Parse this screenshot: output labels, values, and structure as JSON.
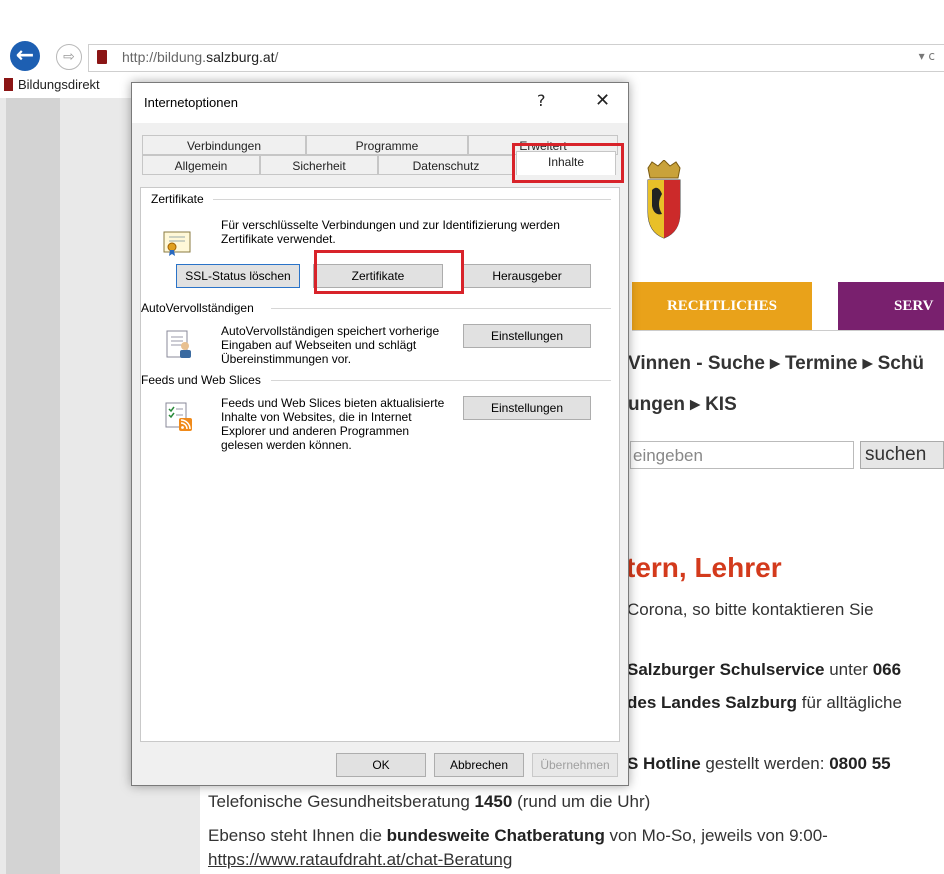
{
  "browser": {
    "url_prefix": "http://bildung.",
    "url_domain": "salzburg.at",
    "url_suffix": "/",
    "tab_title": "Bildungsdirekt"
  },
  "website": {
    "nav": {
      "rechtliches": "RECHTLICHES",
      "service": "SERV"
    },
    "quicklinks_line1": "Vinnen - Suche  ▸ Termine  ▸ Schü",
    "quicklinks_line2": "ungen  ▸ KIS",
    "search_placeholder": "eingeben",
    "search_button": "suchen",
    "heading": "tern, Lehrer",
    "p1": " Corona, so bitte kontaktieren Sie",
    "p2_bold": "Salzburger Schulservice",
    "p2_rest": " unter ",
    "p2_num": "066",
    "p3_bold": "des Landes Salzburg",
    "p3_rest": " für alltägliche",
    "p4_bold": "S Hotline",
    "p4_rest": " gestellt werden: ",
    "p4_num": "0800 55",
    "p5_pre": "Telefonische Gesundheitsberatung ",
    "p5_bold": "1450",
    "p5_post": " (rund um die Uhr)",
    "p6_pre": "Ebenso steht Ihnen die ",
    "p6_bold": "bundesweite Chatberatung",
    "p6_post": " von Mo-So, jeweils von 9:00-",
    "p7_link": "https://www.rataufdraht.at/chat-Beratung"
  },
  "dialog": {
    "title": "Internetoptionen",
    "help": "?",
    "close": "✕",
    "tabs_row1": [
      "Verbindungen",
      "Programme",
      "Erweitert"
    ],
    "tabs_row2": [
      "Allgemein",
      "Sicherheit",
      "Datenschutz",
      "Inhalte"
    ],
    "cert_group": "Zertifikate",
    "cert_text": "Für verschlüsselte Verbindungen und zur Identifizierung werden Zertifikate verwendet.",
    "btn_ssl": "SSL-Status löschen",
    "btn_cert": "Zertifikate",
    "btn_publisher": "Herausgeber",
    "auto_group": "AutoVervollständigen",
    "auto_text": "AutoVervollständigen speichert vorherige Eingaben auf Webseiten und schlägt Übereinstimmungen vor.",
    "btn_auto_settings": "Einstellungen",
    "feeds_group": "Feeds und Web Slices",
    "feeds_text": "Feeds und Web Slices bieten aktualisierte Inhalte von Websites, die in Internet Explorer und anderen Programmen gelesen werden können.",
    "btn_feeds_settings": "Einstellungen",
    "btn_ok": "OK",
    "btn_cancel": "Abbrechen",
    "btn_apply": "Übernehmen"
  },
  "icons": {
    "certificate": "certificate-icon",
    "autocomplete": "autocomplete-icon",
    "feeds": "feeds-icon"
  },
  "colors": {
    "highlight": "#d8232a",
    "nav_orange": "#e9a21a",
    "nav_purple": "#79206e",
    "heading_red": "#d33a1c"
  }
}
